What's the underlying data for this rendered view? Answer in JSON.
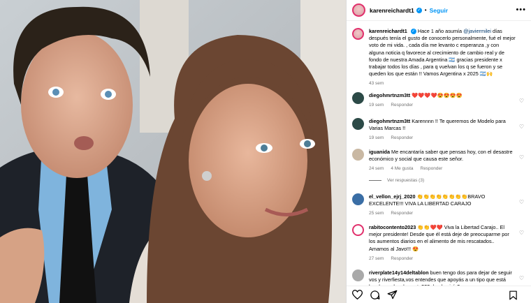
{
  "post": {
    "username": "karenreichardt1",
    "follow_label": "Seguir",
    "caption_user": "karenreichardt1",
    "caption_part1": "Hace 1 año asumía ",
    "caption_mention": "@javiermilei",
    "caption_part2": " días después tenía el gusto de conocerlo personalmente, fué el mejor voto de mi vida. , cada día me levanto c esperanza ,y con alguna noticia q favorece al crecimiento de cambio real y de fondo de nuestra Amada Argentina 🇦🇷 gracias presidente x trabajar todos los días , para q vuelvan los q se fueron y se queden los que están !! Vamos Argentina x 2025 🇦🇷🙌",
    "caption_time": "43 sem"
  },
  "comments": [
    {
      "user": "diegohmrtnzm3tt",
      "text": "❤️❤️❤️❤️😍😍😍😍",
      "time": "19 sem",
      "likes": "",
      "reply": "Responder"
    },
    {
      "user": "diegohmrtnzm3tt",
      "text": "Karennnn !! Te queremos de Modelo para Varias Marcas !!",
      "time": "19 sem",
      "likes": "",
      "reply": "Responder"
    },
    {
      "user": "iguanida",
      "text": "Me encantaría saber que pensas hoy, con el desastre económico y social que causa este señor.",
      "time": "24 sem",
      "likes": "4 Me gusta",
      "reply": "Responder"
    },
    {
      "user": "el_vellon_ejrj_2020",
      "text": "👏👏👏👏👏👏👏👏BRAVO EXCELENTE!!! VIVA LA LIBERTAD CARAJO",
      "time": "25 sem",
      "likes": "",
      "reply": "Responder"
    },
    {
      "user": "rabitocontento2023",
      "text": "👏👏❤️❤️ Viva la Libertad Carajo.. El mejor presidente! Desde que él está deje de preocuparme por los aumentos diarios en el alimento de mis rescatados.. Amamos al Javo!!! 😍",
      "time": "27 sem",
      "likes": "",
      "reply": "Responder"
    },
    {
      "user": "riverplate14y14deltablon",
      "text": "buen tengo dos para dejar de seguir vos y riverfiesta,vos entendes que apoyás a un tipo que está hambreando a la gente??? donde vivís?",
      "time": "",
      "likes": "",
      "reply": ""
    }
  ],
  "see_replies": "Ver respuestas (3)",
  "icons": [
    "verified-badge-icon",
    "more-options-icon",
    "heart-icon",
    "comment-icon",
    "share-icon",
    "bookmark-icon"
  ],
  "colors": {
    "accent": "#0095f6",
    "meta": "#737373",
    "like_red": "#ed4956"
  }
}
